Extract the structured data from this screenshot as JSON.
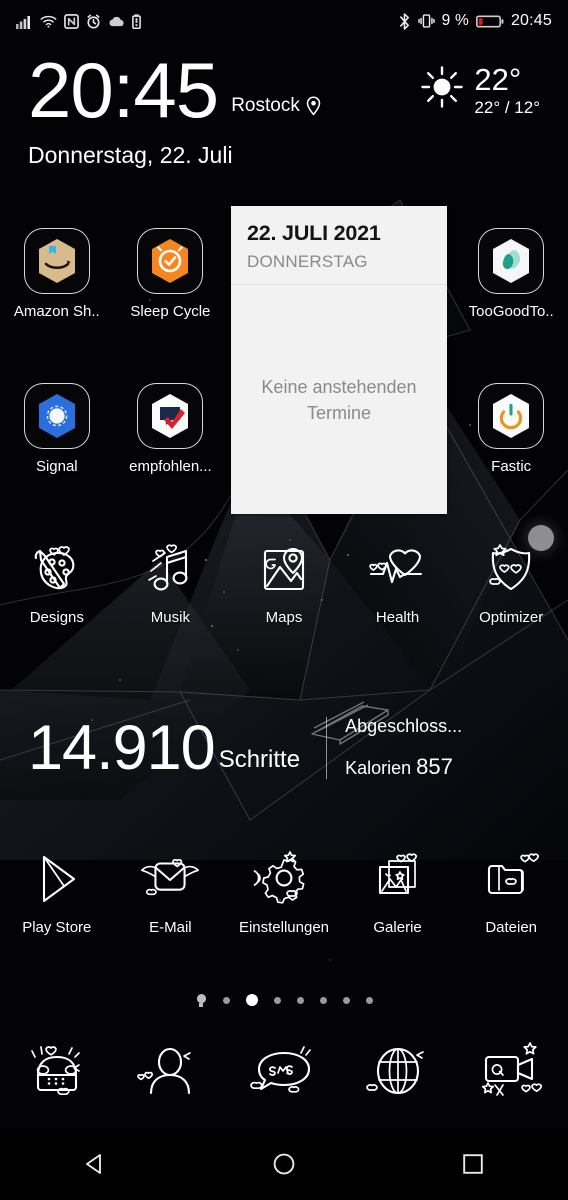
{
  "statusbar": {
    "left_icons": [
      "signal-bars-icon",
      "wifi-icon",
      "nfc-icon",
      "alarm-icon",
      "cloud-icon",
      "battery-saver-icon"
    ],
    "right_icons": [
      "bluetooth-icon",
      "vibrate-icon"
    ],
    "battery_percent": "9 %",
    "clock": "20:45"
  },
  "clock_widget": {
    "time": "20:45",
    "city": "Rostock",
    "location_icon": "location-pin-icon",
    "weather_icon": "sun-icon",
    "temp_now": "22°",
    "temp_range": "22° / 12°",
    "date": "Donnerstag, 22. Juli"
  },
  "calendar_widget": {
    "date": "22. JULI 2021",
    "weekday": "DONNERSTAG",
    "empty_message": "Keine anstehenden Termine"
  },
  "rows": [
    {
      "name": "app-row-1",
      "apps": [
        {
          "label": "Amazon Sh..",
          "icon": "amazon-shopping-icon",
          "style": "boxed"
        },
        {
          "label": "Sleep Cycle",
          "icon": "sleep-cycle-icon",
          "style": "boxed"
        },
        {
          "label": "",
          "icon": "",
          "style": "empty"
        },
        {
          "label": "",
          "icon": "",
          "style": "empty"
        },
        {
          "label": "TooGoodTo..",
          "icon": "toogoodtogo-icon",
          "style": "boxed"
        }
      ]
    },
    {
      "name": "app-row-2",
      "apps": [
        {
          "label": "Signal",
          "icon": "signal-messenger-icon",
          "style": "boxed"
        },
        {
          "label": "empfohlen...",
          "icon": "empfohlen-icon",
          "style": "boxed"
        },
        {
          "label": "",
          "icon": "",
          "style": "empty"
        },
        {
          "label": "",
          "icon": "",
          "style": "empty"
        },
        {
          "label": "Fastic",
          "icon": "fastic-icon",
          "style": "boxed"
        }
      ]
    },
    {
      "name": "app-row-3",
      "apps": [
        {
          "label": "Designs",
          "icon": "palette-icon",
          "style": "sketch"
        },
        {
          "label": "Musik",
          "icon": "music-note-icon",
          "style": "sketch"
        },
        {
          "label": "Maps",
          "icon": "maps-icon",
          "style": "sketch"
        },
        {
          "label": "Health",
          "icon": "heart-pulse-icon",
          "style": "sketch"
        },
        {
          "label": "Optimizer",
          "icon": "shield-icon",
          "style": "sketch"
        }
      ]
    },
    {
      "name": "app-row-4",
      "apps": [
        {
          "label": "Play Store",
          "icon": "play-store-icon",
          "style": "sketch"
        },
        {
          "label": "E-Mail",
          "icon": "envelope-wings-icon",
          "style": "sketch"
        },
        {
          "label": "Einstellungen",
          "icon": "gear-icon",
          "style": "sketch"
        },
        {
          "label": "Galerie",
          "icon": "gallery-icon",
          "style": "sketch"
        },
        {
          "label": "Dateien",
          "icon": "folder-icon",
          "style": "sketch"
        }
      ]
    }
  ],
  "step_widget": {
    "count": "14.910",
    "unit": "Schritte",
    "goal_label": "Abgeschloss...",
    "calories_label": "Kalorien",
    "calories_value": "857",
    "stack_icon": "step-stack-icon"
  },
  "page_indicator": {
    "count": 8,
    "active_index": 2,
    "home_index": 0
  },
  "dock": [
    {
      "label": "phone",
      "icon": "telephone-icon"
    },
    {
      "label": "contacts",
      "icon": "contacts-person-icon"
    },
    {
      "label": "sms",
      "icon": "sms-bubble-icon"
    },
    {
      "label": "browser",
      "icon": "globe-browser-icon"
    },
    {
      "label": "camera",
      "icon": "camera-icon"
    }
  ],
  "navbar": [
    {
      "name": "back-button",
      "icon": "back-triangle-icon"
    },
    {
      "name": "home-button",
      "icon": "home-circle-icon"
    },
    {
      "name": "recents-button",
      "icon": "recents-square-icon"
    }
  ],
  "colors": {
    "background": "#000000",
    "calendar_bg": "#f2f2f2",
    "calendar_text": "#141414",
    "calendar_muted": "#8a8a8a",
    "amazon_tan": "#d8bb8c",
    "sleep_orange": "#f6861f",
    "toogoodtogo_teal": "#1fa08f",
    "signal_blue": "#2a6fdb",
    "fastic_orange": "#e8941a",
    "battery_red": "#e02020",
    "moon_gray": "#8e8e90"
  }
}
